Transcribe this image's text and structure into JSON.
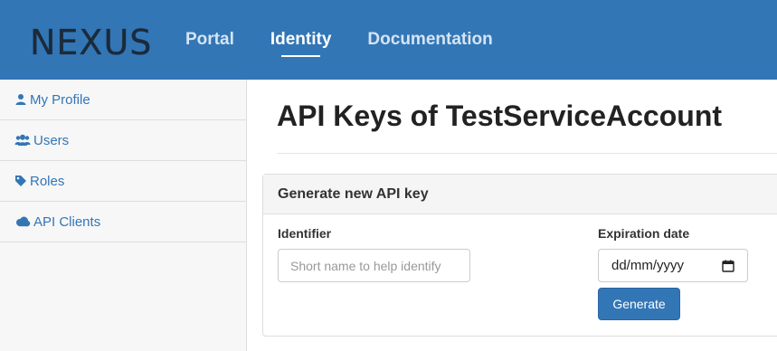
{
  "brand": {
    "logo_text": "NEXUS"
  },
  "nav": {
    "items": [
      {
        "label": "Portal"
      },
      {
        "label": "Identity"
      },
      {
        "label": "Documentation"
      }
    ]
  },
  "sidebar": {
    "items": [
      {
        "label": "My Profile",
        "icon": "user-icon"
      },
      {
        "label": "Users",
        "icon": "users-icon"
      },
      {
        "label": "Roles",
        "icon": "tag-icon"
      },
      {
        "label": "API Clients",
        "icon": "cloud-icon"
      }
    ]
  },
  "main": {
    "title": "API Keys of TestServiceAccount",
    "panel": {
      "heading": "Generate new API key",
      "identifier_label": "Identifier",
      "identifier_placeholder": "Short name to help identify",
      "identifier_value": "",
      "expiration_label": "Expiration date",
      "expiration_placeholder": "dd/mm/yyyy",
      "generate_label": "Generate"
    }
  },
  "colors": {
    "accent": "#3276b6",
    "link": "#3276b6",
    "sidebar_bg": "#f7f7f7"
  }
}
